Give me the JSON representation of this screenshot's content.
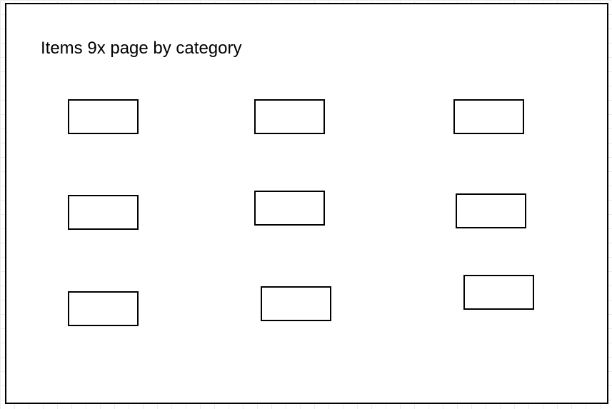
{
  "page": {
    "title": "Items 9x page by category"
  },
  "items": [
    {
      "label": ""
    },
    {
      "label": ""
    },
    {
      "label": ""
    },
    {
      "label": ""
    },
    {
      "label": ""
    },
    {
      "label": ""
    },
    {
      "label": ""
    },
    {
      "label": ""
    },
    {
      "label": ""
    }
  ]
}
